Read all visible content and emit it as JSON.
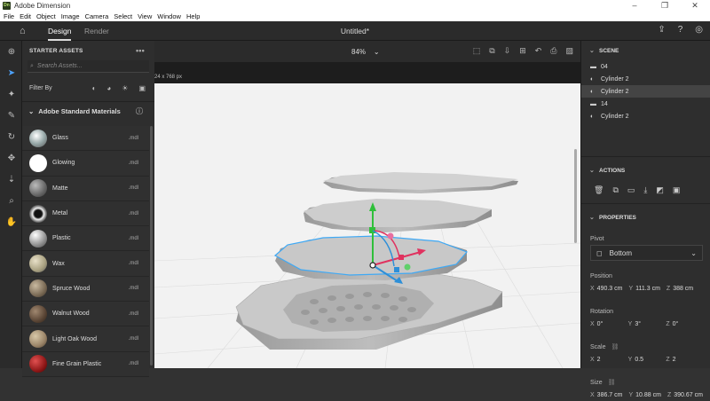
{
  "window": {
    "title": "Adobe Dimension",
    "logo": "Dn"
  },
  "menu": [
    "File",
    "Edit",
    "Object",
    "Image",
    "Camera",
    "Select",
    "View",
    "Window",
    "Help"
  ],
  "appbar": {
    "tabs": [
      "Design",
      "Render"
    ],
    "active_tab": "Design",
    "doc_title": "Untitled*"
  },
  "assets": {
    "header": "STARTER ASSETS",
    "search_placeholder": "Search Assets...",
    "filter_label": "Filter By",
    "section_title": "Adobe Standard Materials",
    "items": [
      {
        "name": "Glass",
        "fmt": ".mdl"
      },
      {
        "name": "Glowing",
        "fmt": ".mdl"
      },
      {
        "name": "Matte",
        "fmt": ".mdl"
      },
      {
        "name": "Metal",
        "fmt": ".mdl"
      },
      {
        "name": "Plastic",
        "fmt": ".mdl"
      },
      {
        "name": "Wax",
        "fmt": ".mdl"
      },
      {
        "name": "Spruce Wood",
        "fmt": ".mdl"
      },
      {
        "name": "Walnut Wood",
        "fmt": ".mdl"
      },
      {
        "name": "Light Oak Wood",
        "fmt": ".mdl"
      },
      {
        "name": "Fine Grain Plastic",
        "fmt": ".mdl"
      }
    ]
  },
  "viewport": {
    "zoom": "84%",
    "canvas_size": "24 x 768 px"
  },
  "scene": {
    "header": "SCENE",
    "items": [
      {
        "label": "04",
        "icon": "folder-icon",
        "selected": false
      },
      {
        "label": "Cylinder 2",
        "icon": "material-icon",
        "selected": false
      },
      {
        "label": "Cylinder 2",
        "icon": "material-icon",
        "selected": true
      },
      {
        "label": "14",
        "icon": "folder-icon",
        "selected": false
      },
      {
        "label": "Cylinder 2",
        "icon": "material-icon",
        "selected": false
      }
    ]
  },
  "actions": {
    "header": "ACTIONS"
  },
  "properties": {
    "header": "PROPERTIES",
    "pivot_label": "Pivot",
    "pivot_value": "Bottom",
    "position_label": "Position",
    "position": {
      "x": "490.3 cm",
      "y": "111.3 cm",
      "z": "388 cm"
    },
    "rotation_label": "Rotation",
    "rotation": {
      "x": "0°",
      "y": "3°",
      "z": "0°"
    },
    "scale_label": "Scale",
    "scale": {
      "x": "2",
      "y": "0.5",
      "z": "2"
    },
    "size_label": "Size",
    "size": {
      "x": "386.7 cm",
      "y": "10.88 cm",
      "z": "390.67 cm"
    }
  },
  "colors": {
    "accent": "#4da3ff",
    "gizmo_y": "#2fbf3a",
    "gizmo_x": "#e0325f",
    "gizmo_z": "#2d8fd8",
    "selection": "#3fa9f5"
  }
}
